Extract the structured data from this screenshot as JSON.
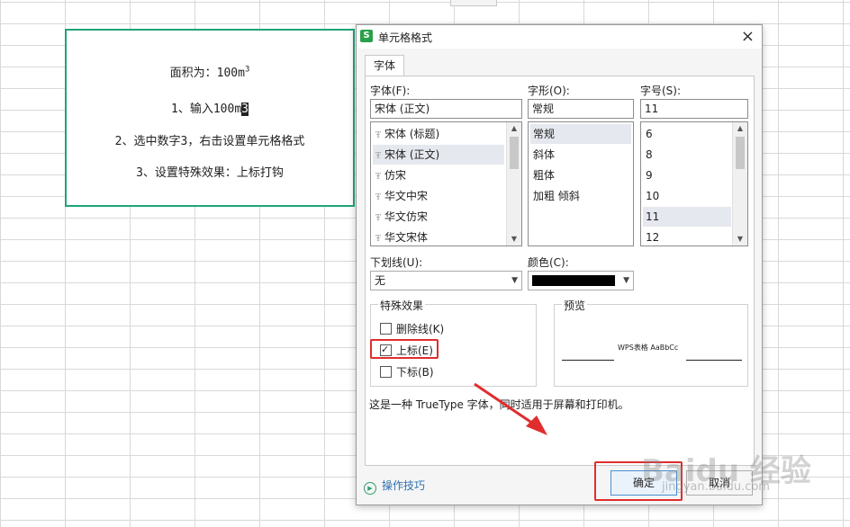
{
  "cell": {
    "line1_prefix": "面积为：100m",
    "line1_sup": "3",
    "line2_prefix": "1、输入100m",
    "line2_cursor": "3",
    "line3": "2、选中数字3，右击设置单元格格式",
    "line4": "3、设置特殊效果：上标打钩"
  },
  "dialog": {
    "title": "单元格格式",
    "app_icon": "S",
    "close": "×",
    "tab": "字体",
    "font": {
      "label": "字体(F):",
      "value": "宋体 (正文)",
      "items": [
        "宋体 (标题)",
        "宋体 (正文)",
        "仿宋",
        "华文中宋",
        "华文仿宋",
        "华文宋体"
      ],
      "selected_index": 1
    },
    "style": {
      "label": "字形(O):",
      "value": "常规",
      "items": [
        "常规",
        "斜体",
        "粗体",
        "加粗 倾斜"
      ],
      "selected_index": 0
    },
    "size": {
      "label": "字号(S):",
      "value": "11",
      "items": [
        "6",
        "8",
        "9",
        "10",
        "11",
        "12"
      ],
      "selected_index": 4
    },
    "underline": {
      "label": "下划线(U):",
      "value": "无"
    },
    "color": {
      "label": "颜色(C):",
      "value": "#000000"
    },
    "effects": {
      "title": "特殊效果",
      "strikethrough": {
        "label": "删除线(K)",
        "checked": false
      },
      "superscript": {
        "label": "上标(E)",
        "checked": true
      },
      "subscript": {
        "label": "下标(B)",
        "checked": false
      }
    },
    "preview": {
      "title": "预览",
      "sample": "WPS表格  AaBbCc"
    },
    "note": "这是一种 TrueType 字体，同时适用于屏幕和打印机。",
    "tips": "操作技巧",
    "ok": "确定",
    "cancel": "取消"
  },
  "watermark": {
    "brand": "Baidu 经验",
    "url": "jingyan.baidu.com"
  },
  "colors": {
    "highlight_red": "#e02d2d",
    "cell_border": "#1fa57a",
    "tips_blue": "#2f6fb0"
  }
}
